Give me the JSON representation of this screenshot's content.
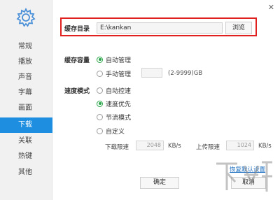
{
  "window": {
    "close_symbol": "✕"
  },
  "sidebar": {
    "logo_icon": "gear-icon",
    "items": [
      {
        "label": "常规"
      },
      {
        "label": "播放"
      },
      {
        "label": "声音"
      },
      {
        "label": "字幕"
      },
      {
        "label": "画面"
      },
      {
        "label": "下载",
        "active": true
      },
      {
        "label": "关联"
      },
      {
        "label": "热键"
      },
      {
        "label": "其他"
      }
    ]
  },
  "cache_dir": {
    "label": "缓存目录",
    "value": "E:\\kankan",
    "browse_label": "浏览"
  },
  "cache_capacity": {
    "label": "缓存容量",
    "auto_label": "自动管理",
    "auto_selected": true,
    "manual_label": "手动管理",
    "manual_hint": "(2-9999)GB"
  },
  "speed_mode": {
    "label": "速度模式",
    "options": [
      {
        "label": "自动控速",
        "selected": false
      },
      {
        "label": "速度优先",
        "selected": true
      },
      {
        "label": "节流模式",
        "selected": false
      },
      {
        "label": "自定义",
        "selected": false
      }
    ]
  },
  "limits": {
    "download_label": "下载限速",
    "download_value": "2048",
    "download_unit": "KB/s",
    "upload_label": "上传限速",
    "upload_value": "1024",
    "upload_unit": "KB/s"
  },
  "footer": {
    "restore_label": "恢复默认设置",
    "ok_label": "确定",
    "cancel_label": "取消"
  },
  "colors": {
    "active_nav": "#1e8fe0",
    "highlight_border": "#e0201f",
    "radio_on": "#2aa54a",
    "link": "#1e6fc0"
  }
}
